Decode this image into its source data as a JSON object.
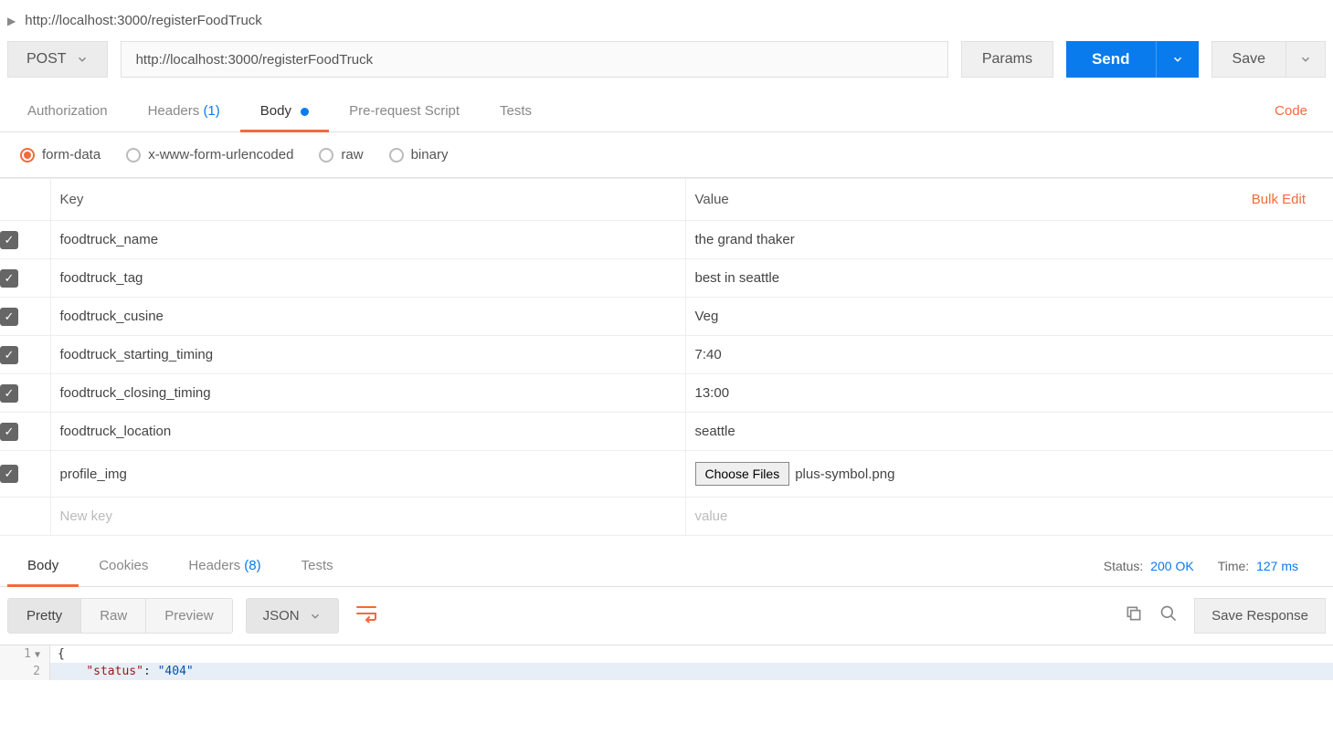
{
  "breadcrumb": {
    "url": "http://localhost:3000/registerFoodTruck"
  },
  "request": {
    "method": "POST",
    "url": "http://localhost:3000/registerFoodTruck",
    "params_label": "Params",
    "send_label": "Send",
    "save_label": "Save"
  },
  "tabs": {
    "authorization": "Authorization",
    "headers": "Headers",
    "headers_count": "(1)",
    "body": "Body",
    "prerequest": "Pre-request Script",
    "tests": "Tests",
    "code": "Code"
  },
  "body_types": {
    "form_data": "form-data",
    "urlencoded": "x-www-form-urlencoded",
    "raw": "raw",
    "binary": "binary"
  },
  "kv_headers": {
    "key": "Key",
    "value": "Value",
    "bulk_edit": "Bulk Edit"
  },
  "form_rows": [
    {
      "key": "foodtruck_name",
      "value": "the grand thaker",
      "file": false
    },
    {
      "key": "foodtruck_tag",
      "value": "best in seattle",
      "file": false
    },
    {
      "key": "foodtruck_cusine",
      "value": "Veg",
      "file": false
    },
    {
      "key": "foodtruck_starting_timing",
      "value": "7:40",
      "file": false
    },
    {
      "key": "foodtruck_closing_timing",
      "value": "13:00",
      "file": false
    },
    {
      "key": "foodtruck_location",
      "value": "seattle",
      "file": false
    },
    {
      "key": "profile_img",
      "value": "plus-symbol.png",
      "file": true
    }
  ],
  "form_placeholder": {
    "key": "New key",
    "value": "value"
  },
  "file_button": "Choose Files",
  "response_tabs": {
    "body": "Body",
    "cookies": "Cookies",
    "headers": "Headers",
    "headers_count": "(8)",
    "tests": "Tests"
  },
  "status": {
    "status_label": "Status:",
    "status_value": "200 OK",
    "time_label": "Time:",
    "time_value": "127 ms"
  },
  "response_toolbar": {
    "pretty": "Pretty",
    "raw": "Raw",
    "preview": "Preview",
    "format": "JSON",
    "save_response": "Save Response"
  },
  "response_body": {
    "line1_num": "1",
    "line1": "{",
    "line2_num": "2",
    "line2_key": "\"status\"",
    "line2_sep": ": ",
    "line2_val": "\"404\""
  }
}
